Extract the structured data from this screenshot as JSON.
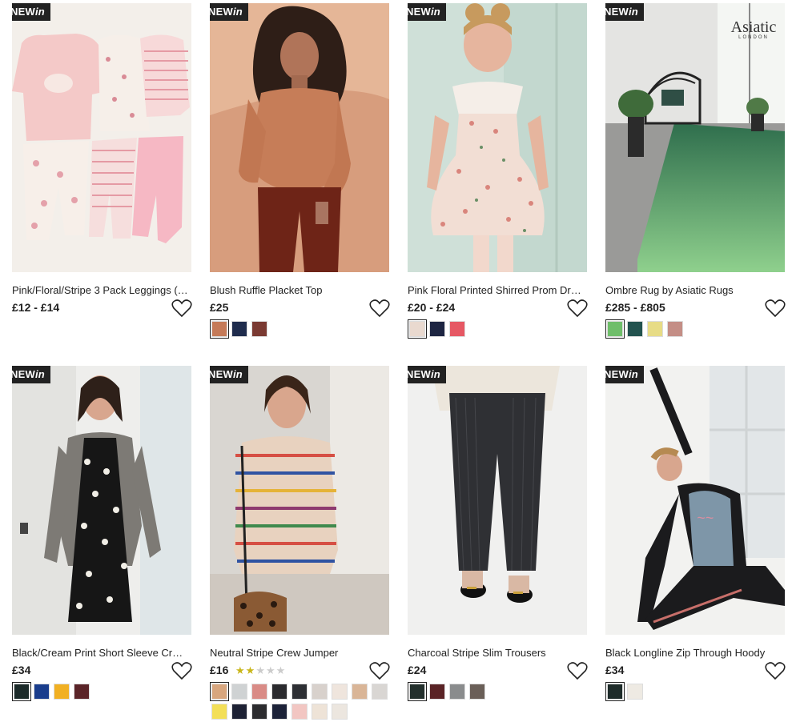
{
  "badge": {
    "new": "NEW",
    "in": "in"
  },
  "products": [
    {
      "title": "Pink/Floral/Stripe 3 Pack Leggings (0...",
      "price": "£12 - £14",
      "swatches": []
    },
    {
      "title": "Blush Ruffle Placket Top",
      "price": "£25",
      "swatches": [
        "#c57a58",
        "#1f2c4d",
        "#7a3a32"
      ]
    },
    {
      "title": "Pink Floral Printed Shirred Prom Dress ...",
      "price": "£20 - £24",
      "swatches": [
        "#e9d9cf",
        "#1d2542",
        "#e65864"
      ]
    },
    {
      "title": "Ombre Rug by Asiatic Rugs",
      "price": "£285 - £805",
      "swatches": [
        "#6fbe6a",
        "#23534f",
        "#e7dc86",
        "#c48e86"
      ],
      "brand_logo": "Asiatic",
      "brand_sub": "LONDON"
    },
    {
      "title": "Black/Cream Print Short Sleeve Crepe ...",
      "price": "£34",
      "swatches": [
        "#1c2b2a",
        "#1a3d8c",
        "#f1b023",
        "#5a2428"
      ]
    },
    {
      "title": "Neutral Stripe Crew Jumper",
      "price": "£16",
      "rating": 2,
      "rating_max": 5,
      "swatches": [
        "#d8a67e",
        "#cfd2d3",
        "#d98b86",
        "#2a2a2e",
        "#2d2f34",
        "#d8d1cc",
        "#efe5dd",
        "#d9b597",
        "#d9d6d3",
        "#f3df58",
        "#1d2134",
        "#2b2b2e",
        "#1c2238",
        "#f2c6c2",
        "#eee3d7",
        "#ece6df"
      ]
    },
    {
      "title": "Charcoal Stripe Slim Trousers",
      "price": "£24",
      "swatches": [
        "#23302d",
        "#5a2326",
        "#8a8c8d",
        "#6a5f58"
      ]
    },
    {
      "title": "Black Longline Zip Through Hoody",
      "price": "£34",
      "swatches": [
        "#1e2c2a",
        "#eeeae3"
      ]
    }
  ]
}
